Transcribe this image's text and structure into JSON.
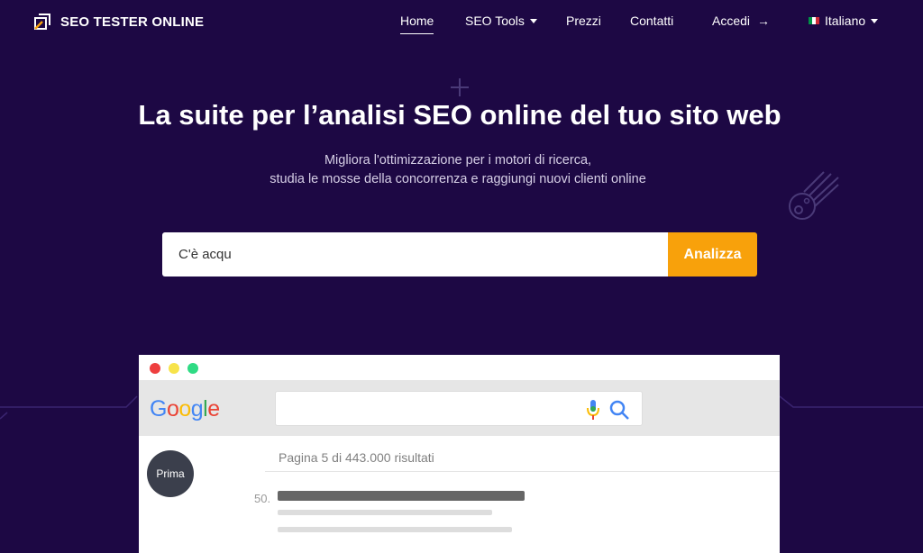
{
  "brand": {
    "name": "SEO TESTER ONLINE",
    "icon": "logo-box-icon"
  },
  "nav": {
    "home": "Home",
    "seo_tools": "SEO Tools",
    "prices": "Prezzi",
    "contacts": "Contatti",
    "login": "Accedi",
    "language": "Italiano"
  },
  "hero": {
    "title": "La suite per l’analisi SEO online del tuo sito web",
    "subtitle_line1": "Migliora l'ottimizzazione per i motori di ricerca,",
    "subtitle_line2": "studia le mosse della concorrenza e raggiungi nuovi clienti online"
  },
  "search": {
    "value": "C'è acqu",
    "button": "Analizza"
  },
  "mockup": {
    "google_logo": [
      "G",
      "o",
      "o",
      "g",
      "l",
      "e"
    ],
    "google_colors": [
      "#4285F4",
      "#EA4335",
      "#FBBC05",
      "#4285F4",
      "#34A853",
      "#EA4335"
    ],
    "results_count": "Pagina 5 di 443.000 risultati",
    "badge": "Prima",
    "rank": "50."
  },
  "colors": {
    "background": "#1d0844",
    "accent": "#f8a10b",
    "dot_red": "#ee3f3f",
    "dot_yellow": "#f7e34a",
    "dot_green": "#2fdb84"
  }
}
